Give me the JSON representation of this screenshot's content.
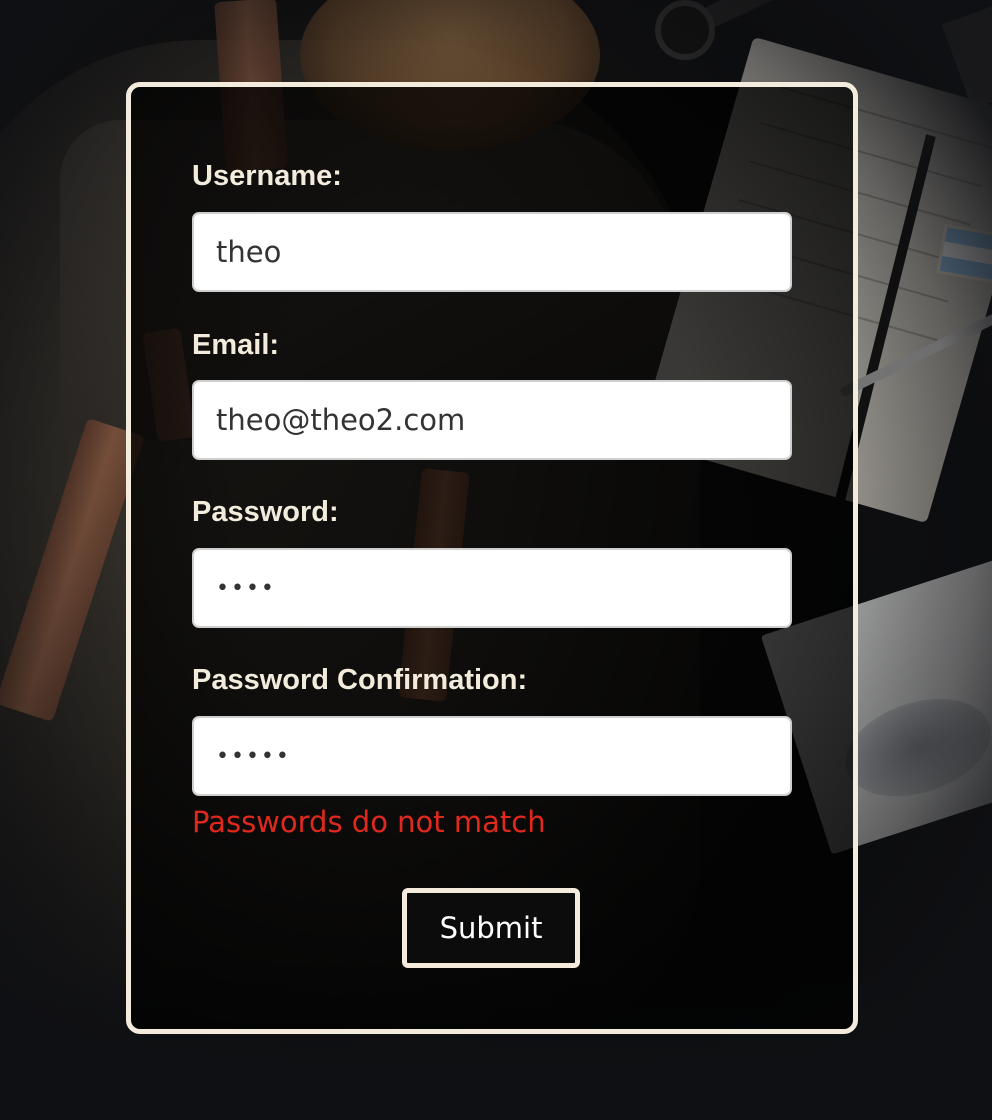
{
  "form": {
    "username": {
      "label": "Username:",
      "value": "theo"
    },
    "email": {
      "label": "Email:",
      "value": "theo@theo2.com"
    },
    "password": {
      "label": "Password:",
      "value": "••••"
    },
    "password_confirmation": {
      "label": "Password Confirmation:",
      "value": "•••••"
    },
    "error_message": "Passwords do not match",
    "submit_label": "Submit"
  },
  "colors": {
    "card_border": "#f3ecdd",
    "label_text": "#f3ecdd",
    "error_text": "#e0291c",
    "button_background": "#0c0c0c",
    "page_background": "#0f1013"
  }
}
